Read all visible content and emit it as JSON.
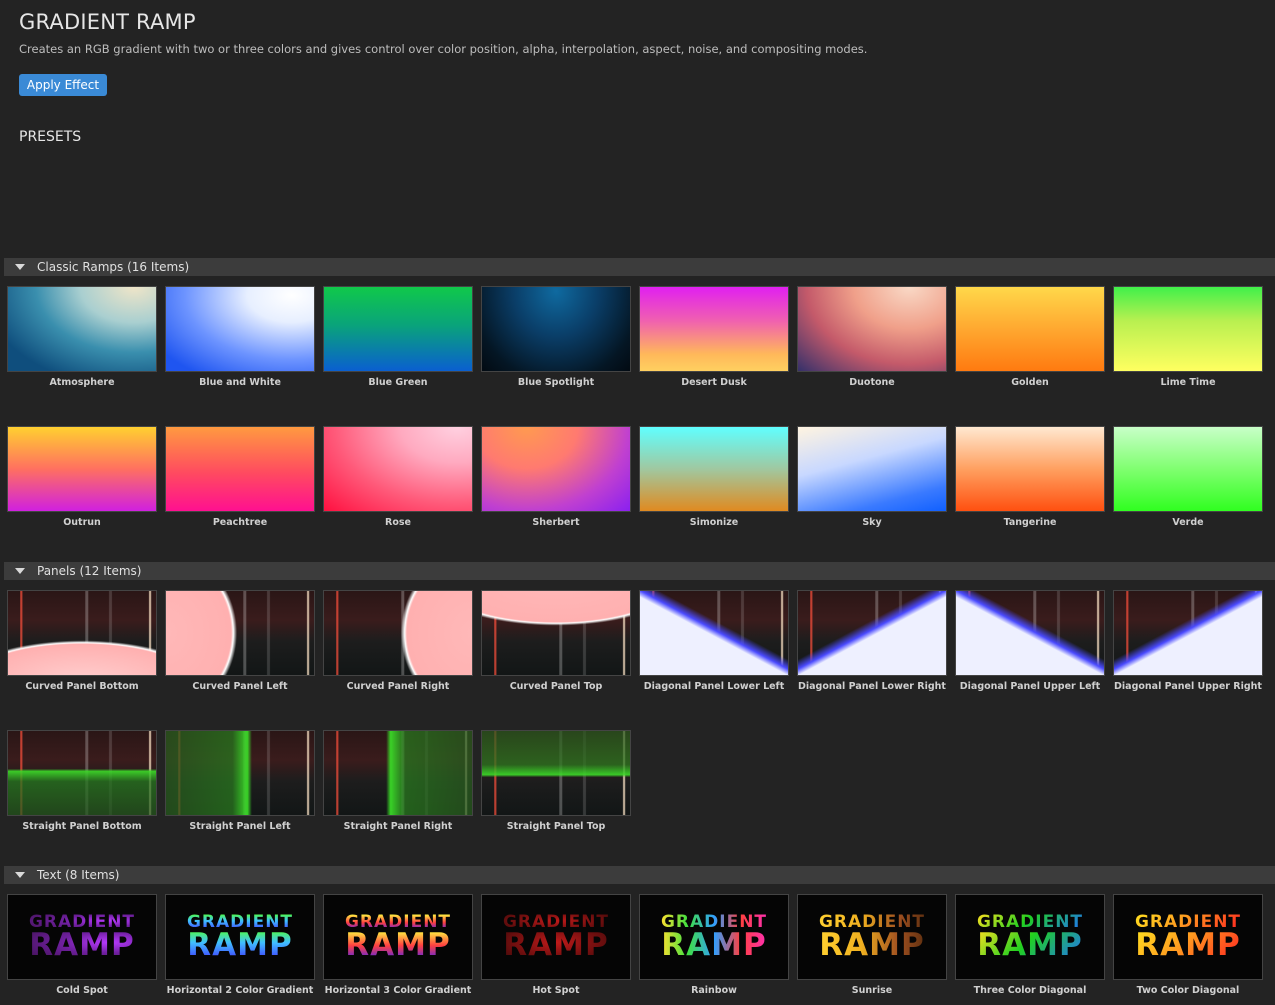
{
  "header": {
    "title": "GRADIENT RAMP",
    "description": "Creates an RGB gradient with two or three colors and gives control over color position, alpha, interpolation, aspect, noise, and compositing modes.",
    "apply_label": "Apply Effect",
    "presets_label": "PRESETS"
  },
  "sections": [
    {
      "label": "Classic Ramps (16 Items)",
      "items": [
        "Atmosphere",
        "Blue and White",
        "Blue Green",
        "Blue Spotlight",
        "Desert Dusk",
        "Duotone",
        "Golden",
        "Lime Time",
        "Outrun",
        "Peachtree",
        "Rose",
        "Sherbert",
        "Simonize",
        "Sky",
        "Tangerine",
        "Verde"
      ]
    },
    {
      "label": "Panels (12 Items)",
      "items": [
        "Curved Panel Bottom",
        "Curved Panel Left",
        "Curved Panel Right",
        "Curved Panel Top",
        "Diagonal Panel Lower Left",
        "Diagonal Panel Lower Right",
        "Diagonal Panel Upper Left",
        "Diagonal Panel Upper Right",
        "Straight Panel Bottom",
        "Straight Panel Left",
        "Straight Panel Right",
        "Straight Panel Top"
      ]
    },
    {
      "label": "Text (8 Items)",
      "items": [
        "Cold Spot",
        "Horizontal 2 Color Gradient",
        "Horizontal 3 Color Gradient",
        "Hot Spot",
        "Rainbow",
        "Sunrise",
        "Three Color Diagonal",
        "Two Color Diagonal"
      ],
      "thumb_text": {
        "line1": "GRADIENT",
        "line2": "RAMP"
      }
    }
  ],
  "colors": {
    "background": "#232323",
    "section_bar": "#3c3c3c",
    "accent": "#3a8ad6"
  }
}
